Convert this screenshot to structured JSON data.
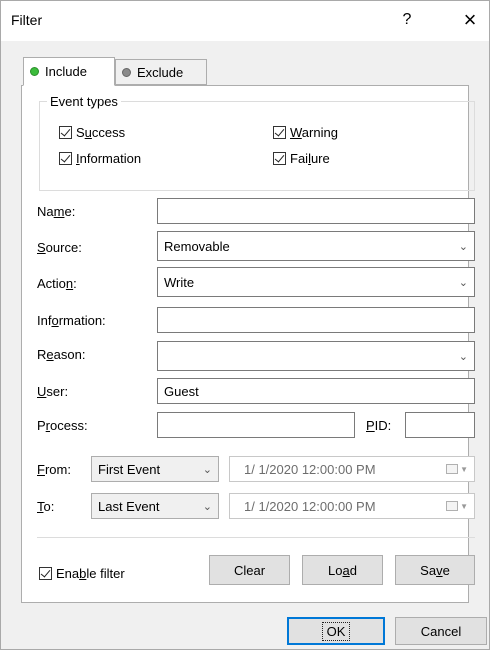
{
  "dialog": {
    "title": "Filter",
    "help": "?",
    "close": "×"
  },
  "tabs": [
    {
      "label": "Include",
      "active": true,
      "dot_color": "#3cbc3c"
    },
    {
      "label": "Exclude",
      "active": false,
      "dot_color": "#8a8a8a"
    }
  ],
  "event_types": {
    "title": "Event types",
    "success": {
      "pre": "S",
      "u": "u",
      "post": "ccess",
      "checked": true
    },
    "warning": {
      "pre": "",
      "u": "W",
      "post": "arning",
      "checked": true
    },
    "information": {
      "pre": "",
      "u": "I",
      "post": "nformation",
      "checked": true
    },
    "failure": {
      "pre": "Fai",
      "u": "l",
      "post": "ure",
      "checked": true
    }
  },
  "fields": {
    "name": {
      "pre": "Na",
      "u": "m",
      "post": "e:",
      "value": ""
    },
    "source": {
      "pre": "",
      "u": "S",
      "post": "ource:",
      "value": "Removable"
    },
    "action": {
      "pre": "Actio",
      "u": "n",
      "post": ":",
      "value": "Write"
    },
    "information": {
      "pre": "Inf",
      "u": "o",
      "post": "rmation:",
      "value": ""
    },
    "reason": {
      "pre": "R",
      "u": "e",
      "post": "ason:",
      "value": ""
    },
    "user": {
      "pre": "",
      "u": "U",
      "post": "ser:",
      "value": "Guest"
    },
    "process": {
      "pre": "P",
      "u": "r",
      "post": "ocess:",
      "value": ""
    },
    "pid": {
      "pre": "",
      "u": "P",
      "post": "ID:",
      "value": ""
    }
  },
  "range": {
    "from": {
      "pre": "",
      "u": "F",
      "post": "rom:",
      "selected": "First Event",
      "date": "1/  1/2020 12:00:00 PM"
    },
    "to": {
      "pre": "",
      "u": "T",
      "post": "o:",
      "selected": "Last Event",
      "date": "1/  1/2020 12:00:00 PM"
    }
  },
  "enable_filter": {
    "pre": "Ena",
    "u": "b",
    "post": "le filter",
    "checked": true
  },
  "buttons": {
    "clear": {
      "label": "Clear"
    },
    "load": {
      "pre": "Lo",
      "u": "a",
      "post": "d"
    },
    "save": {
      "pre": "Sa",
      "u": "v",
      "post": "e"
    },
    "ok": {
      "label": "OK"
    },
    "cancel": {
      "label": "Cancel"
    }
  },
  "icons": [
    "help-icon",
    "close-icon",
    "status-dot-icon",
    "checkbox-check-icon",
    "chevron-down-icon",
    "calendar-icon"
  ]
}
